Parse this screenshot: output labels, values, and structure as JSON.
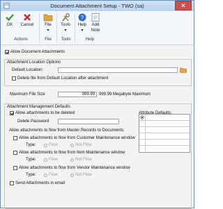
{
  "window": {
    "title": "Document Attachment Setup  -  TWO (sa)",
    "close_glyph": "✕"
  },
  "ribbon": {
    "buttons": [
      {
        "label": "OK",
        "icon": "checkmark-icon"
      },
      {
        "label": "Cancel",
        "icon": "cancel-x-icon"
      },
      {
        "label": "File",
        "icon": "folder-icon"
      },
      {
        "label": "Tools",
        "icon": "tools-icon"
      },
      {
        "label": "Help",
        "icon": "help-icon"
      },
      {
        "label": "Add Note",
        "label_line1": "Add",
        "label_line2": "Note",
        "icon": "note-icon"
      }
    ],
    "groups": {
      "actions": "Actions",
      "file": "File",
      "tools": "Tools",
      "help": "Help"
    },
    "dropdown_glyph": "▾"
  },
  "form": {
    "allow_attachments": {
      "label": "Allow Document Attachments",
      "checked": true
    },
    "location_options_title": "Attachment Location Options",
    "default_location_label": "Default Location:",
    "default_location_value": "",
    "delete_file_label": "Delete file from Default Location after attachment",
    "delete_file_checked": false,
    "max_file_size_label": "Maximum File Size",
    "max_file_size_value": "999.99",
    "max_file_size_unit": "999.99 Megabyte Maximum",
    "management_title": "Attachment Management Defaults",
    "allow_delete": {
      "label": "Allow attachments to be deleted",
      "checked": true
    },
    "delete_password_label": "Delete Password",
    "delete_password_value": "",
    "attribute_defaults_label": "Attribute Defaults:",
    "flow_title": "Allow attachments to flow from Master Records to Documents:",
    "flow_items": [
      {
        "label": "Allow attachments to flow from Customer Maintenance window",
        "checked": false,
        "type_label": "Type:",
        "opt_flow": "Flow",
        "opt_not_flow": "Not Flow",
        "selected": "Not Flow"
      },
      {
        "label": "Allow attachments to flow from Item Maintenance window",
        "checked": false,
        "type_label": "Type:",
        "opt_flow": "Flow",
        "opt_not_flow": "Not Flow",
        "selected": "Not Flow"
      },
      {
        "label": "Allow attachments to flow from Vendor Maintenance window",
        "checked": false,
        "type_label": "Type:",
        "opt_flow": "Flow",
        "opt_not_flow": "Not Flow",
        "selected": "Not Flow"
      }
    ],
    "send_email": {
      "label": "Send Attachments in email",
      "checked": false
    }
  },
  "colors": {
    "ok": "#2e9e3a",
    "cancel": "#cc2a2a",
    "folder": "#e0a63a",
    "help": "#2f6fc0"
  }
}
